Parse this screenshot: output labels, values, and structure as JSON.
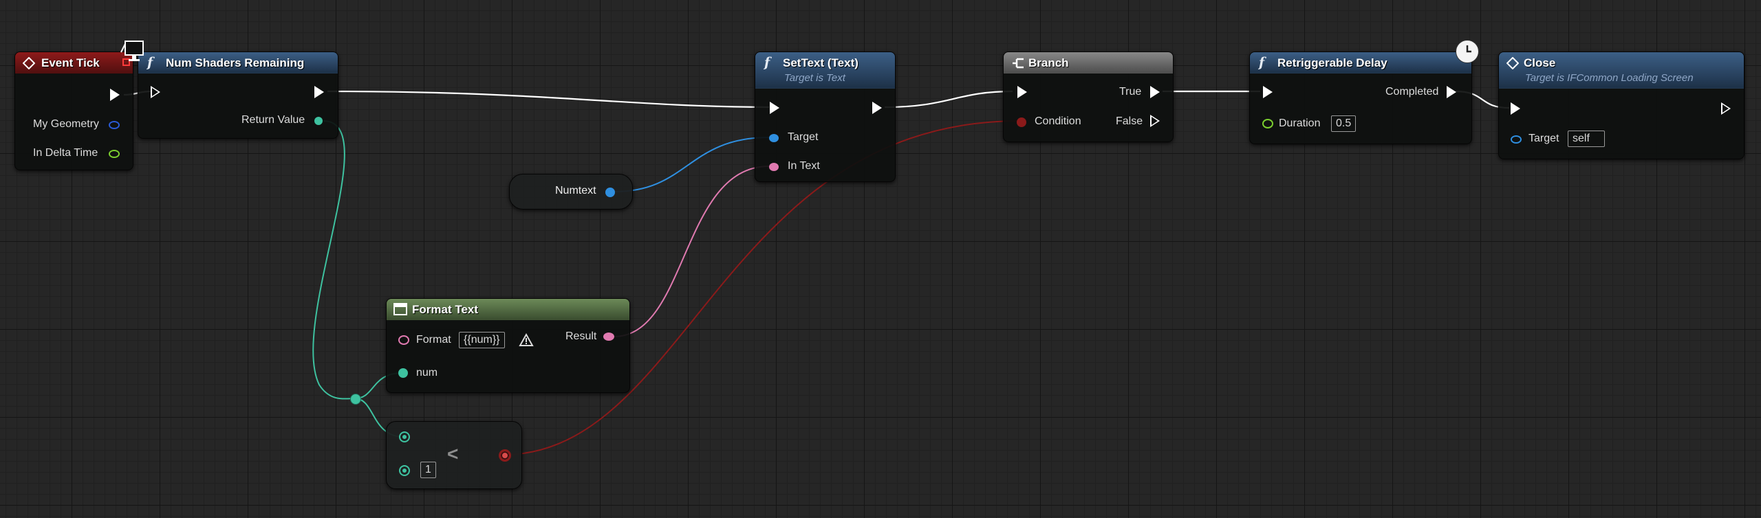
{
  "colors": {
    "exec": "#ffffff",
    "object": "#2f8fe0",
    "text": "#e07ab0",
    "integer": "#3ec2a0",
    "boolean": "#8b1a1a",
    "float": "#7ccf2f",
    "struct": "#2a5bd7"
  },
  "nodes": {
    "event_tick": {
      "title": "Event Tick",
      "pins": {
        "my_geometry": "My Geometry",
        "in_delta_time": "In Delta Time"
      }
    },
    "num_shaders": {
      "title": "Num Shaders Remaining",
      "pins": {
        "return_value": "Return Value"
      }
    },
    "set_text": {
      "title": "SetText (Text)",
      "subtitle": "Target is Text",
      "pins": {
        "target": "Target",
        "in_text": "In Text"
      }
    },
    "branch": {
      "title": "Branch",
      "pins": {
        "condition": "Condition",
        "true": "True",
        "false": "False"
      }
    },
    "delay": {
      "title": "Retriggerable Delay",
      "pins": {
        "completed": "Completed",
        "duration": "Duration",
        "duration_value": "0.5"
      }
    },
    "close": {
      "title": "Close",
      "subtitle": "Target is IFCommon Loading Screen",
      "pins": {
        "target": "Target",
        "target_value": "self"
      }
    },
    "numtext": {
      "label": "Numtext"
    },
    "format_text": {
      "title": "Format Text",
      "pins": {
        "format": "Format",
        "format_value": "{{num}}",
        "num": "num",
        "result": "Result"
      }
    },
    "less": {
      "operator": "<",
      "b_value": "1"
    }
  },
  "icons": {
    "event": "diamond-icon",
    "function": "function-icon",
    "branch": "branch-icon",
    "format": "format-text-icon",
    "delay": "clock-icon",
    "breakpoint": "breakpoint-icon",
    "warning": "warning-icon",
    "monitor": "monitor-icon"
  },
  "function_glyph": "f"
}
